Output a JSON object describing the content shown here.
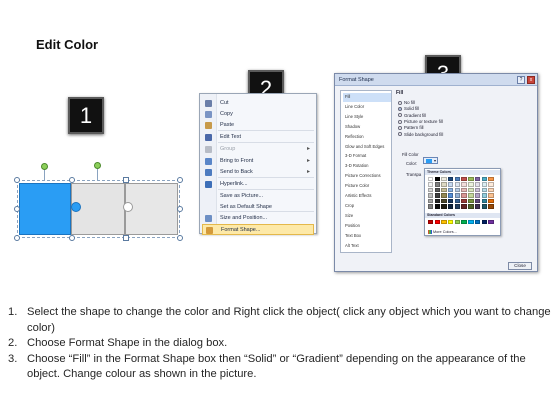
{
  "title": "Edit Color",
  "badges": [
    "1",
    "2",
    "3"
  ],
  "context_menu": {
    "items": [
      {
        "label": "Cut",
        "icon": "scissors-icon",
        "submenu": false,
        "disabled": false,
        "color": "#6a7ea8"
      },
      {
        "label": "Copy",
        "icon": "copy-icon",
        "submenu": false,
        "disabled": false,
        "color": "#7a94c4"
      },
      {
        "label": "Paste",
        "icon": "paste-icon",
        "submenu": false,
        "disabled": false,
        "color": "#c79a4a"
      },
      {
        "label": "Edit Text",
        "icon": "edit-text-icon",
        "submenu": false,
        "disabled": false,
        "color": "#4a68a8"
      },
      {
        "label": "Group",
        "icon": "group-icon",
        "submenu": true,
        "disabled": true,
        "color": "#b7bcc6"
      },
      {
        "label": "Bring to Front",
        "icon": "bring-to-front-icon",
        "submenu": true,
        "disabled": false,
        "color": "#5a86c8"
      },
      {
        "label": "Send to Back",
        "icon": "send-to-back-icon",
        "submenu": true,
        "disabled": false,
        "color": "#4d7bbf"
      },
      {
        "label": "Hyperlink...",
        "icon": "hyperlink-icon",
        "submenu": false,
        "disabled": false,
        "color": "#3d6fb8"
      },
      {
        "label": "Save as Picture...",
        "icon": "",
        "submenu": false,
        "disabled": false,
        "color": ""
      },
      {
        "label": "Set as Default Shape",
        "icon": "",
        "submenu": false,
        "disabled": false,
        "color": ""
      },
      {
        "label": "Size and Position...",
        "icon": "size-position-icon",
        "submenu": false,
        "disabled": false,
        "color": "#6d8fc4"
      },
      {
        "label": "Format Shape...",
        "icon": "format-shape-icon",
        "submenu": false,
        "disabled": false,
        "highlighted": true,
        "color": "#d49a3a"
      }
    ]
  },
  "dialog": {
    "title": "Format Shape",
    "help_label": "?",
    "close_icon_label": "x",
    "categories": [
      "Fill",
      "Line Color",
      "Line Style",
      "Shadow",
      "Reflection",
      "Glow and Soft Edges",
      "3-D Format",
      "3-D Rotation",
      "Picture Corrections",
      "Picture Color",
      "Artistic Effects",
      "Crop",
      "Size",
      "Position",
      "Text Box",
      "Alt Text"
    ],
    "selected_category": "Fill",
    "heading": "Fill",
    "options": [
      {
        "label": "No fill",
        "selected": false
      },
      {
        "label": "Solid fill",
        "selected": true
      },
      {
        "label": "Gradient fill",
        "selected": false
      },
      {
        "label": "Picture or texture fill",
        "selected": false
      },
      {
        "label": "Pattern fill",
        "selected": false
      },
      {
        "label": "Slide background fill",
        "selected": false
      }
    ],
    "fill_color_label": "Fill Color",
    "color_label": "Color:",
    "transparency_label": "Transpa",
    "close_button": "Close"
  },
  "palette": {
    "theme_colors_label": "Theme Colors",
    "standard_colors_label": "Standard Colors",
    "more_colors_label": "More Colors...",
    "theme_rows": [
      [
        "#ffffff",
        "#000000",
        "#eeece1",
        "#1f497d",
        "#4f81bd",
        "#c0504d",
        "#9bbb59",
        "#8064a2",
        "#4bacc6",
        "#f79646"
      ],
      [
        "#f2f2f2",
        "#7f7f7f",
        "#ddd9c3",
        "#c6d9f0",
        "#dbe5f1",
        "#f2dcdb",
        "#ebf1dd",
        "#e5e0ec",
        "#dbeef3",
        "#fdeada"
      ],
      [
        "#d8d8d8",
        "#595959",
        "#c4bd97",
        "#8db3e2",
        "#b8cce4",
        "#e5b9b7",
        "#d7e3bc",
        "#ccc1d9",
        "#b7dde8",
        "#fbd5b5"
      ],
      [
        "#bfbfbf",
        "#3f3f3f",
        "#938953",
        "#548dd4",
        "#95b3d7",
        "#d99694",
        "#c3d69b",
        "#b2a2c7",
        "#92cddc",
        "#fac08f"
      ],
      [
        "#a5a5a5",
        "#262626",
        "#494429",
        "#17365d",
        "#366092",
        "#953734",
        "#76923c",
        "#5f497a",
        "#31859b",
        "#e36c09"
      ],
      [
        "#7f7f7f",
        "#0c0c0c",
        "#1d1b10",
        "#0f243e",
        "#244061",
        "#632423",
        "#4f6128",
        "#3f3151",
        "#205867",
        "#974806"
      ]
    ],
    "standard_row": [
      "#c00000",
      "#ff0000",
      "#ffc000",
      "#ffff00",
      "#92d050",
      "#00b050",
      "#00b0f0",
      "#0070c0",
      "#002060",
      "#7030a0"
    ]
  },
  "instructions": [
    {
      "num": "1.",
      "text": "Select the shape to change the color and Right click the object( click any object which you want to change color)"
    },
    {
      "num": "2.",
      "text": "Choose Format Shape in the dialog box."
    },
    {
      "num": "3.",
      "text": "Choose “Fill” in the Format Shape box then “Solid” or “Gradient” depending on the appearance of the object. Change colour as shown in the picture."
    }
  ]
}
